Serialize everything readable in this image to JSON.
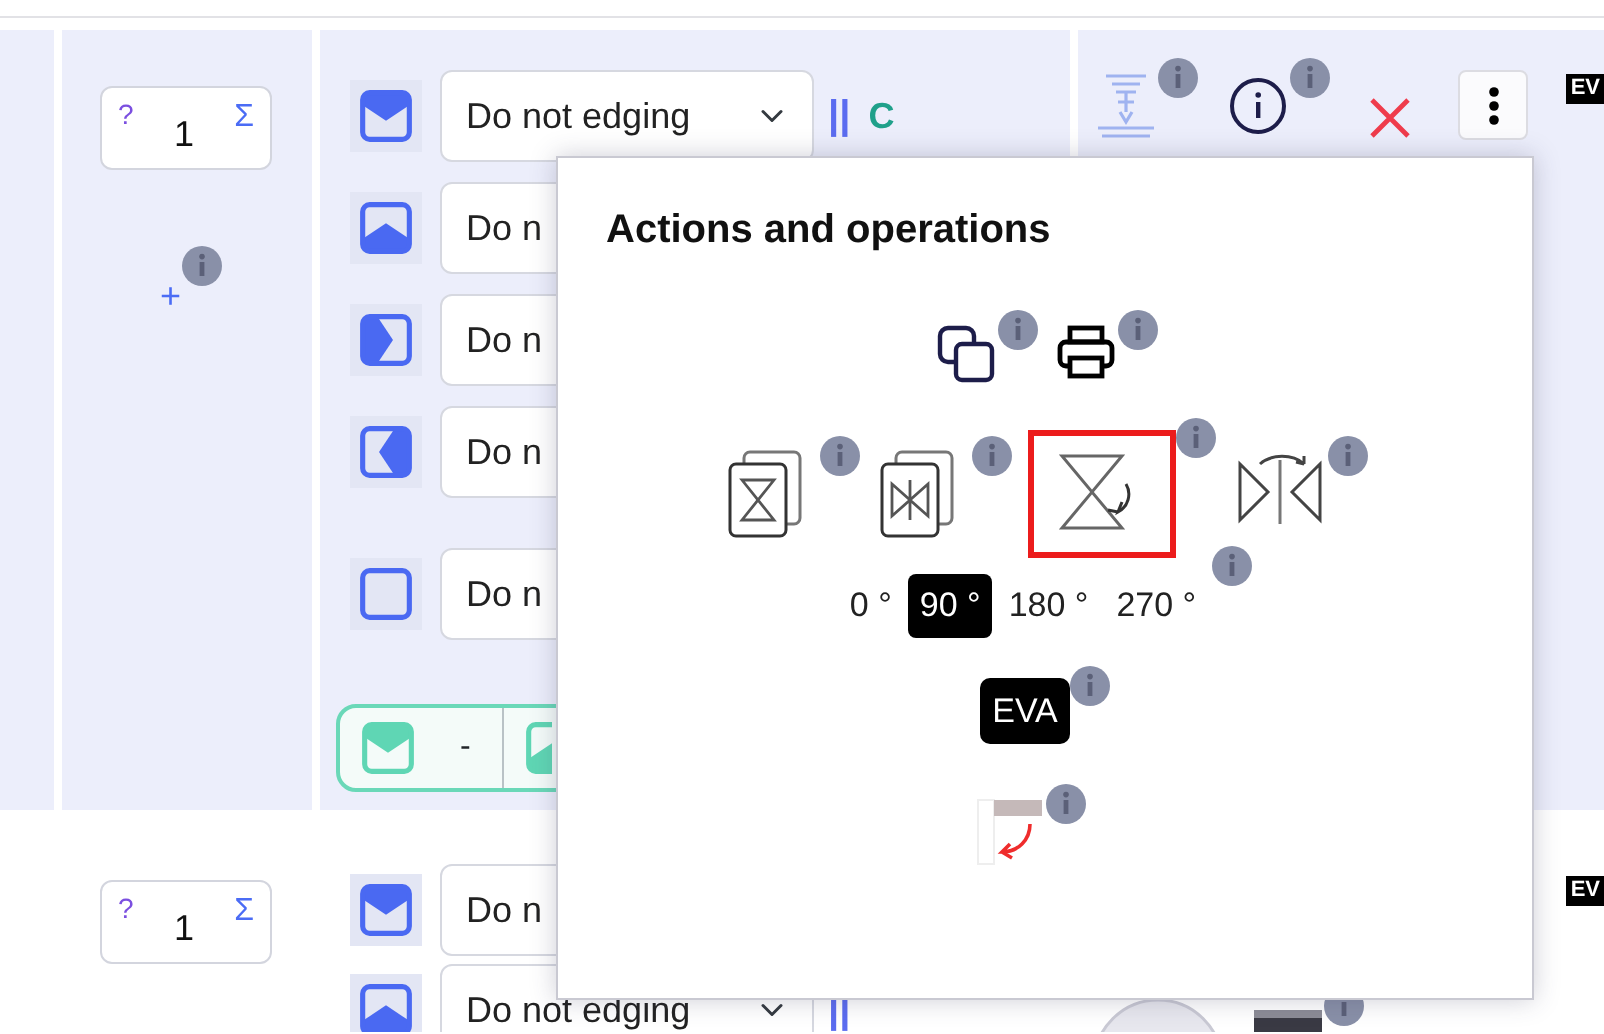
{
  "rows": [
    {
      "quantity": {
        "hint": "?",
        "value": "1",
        "total": "Σ"
      },
      "add": "+",
      "edges": [
        {
          "kind": "top",
          "value": "Do not edging",
          "marks": [
            {
              "kind": "bars",
              "text": "||"
            },
            {
              "kind": "letter",
              "text": "C"
            }
          ]
        },
        {
          "kind": "bottom",
          "value": "Do n"
        },
        {
          "kind": "right",
          "value": "Do n"
        },
        {
          "kind": "left",
          "value": "Do n"
        },
        {
          "kind": "none",
          "value": "Do n"
        }
      ],
      "summary": [
        {
          "kind": "top",
          "value": "-"
        },
        {
          "kind": "bottom"
        }
      ],
      "badge": "EV"
    },
    {
      "quantity": {
        "hint": "?",
        "value": "1",
        "total": "Σ"
      },
      "edges": [
        {
          "kind": "top",
          "value": "Do n"
        },
        {
          "kind": "bottom",
          "value": "Do not edging",
          "marks": [
            {
              "kind": "bars",
              "text": "||"
            }
          ]
        }
      ],
      "badge": "EV"
    }
  ],
  "popover": {
    "title": "Actions and operations",
    "actions": [
      {
        "kind": "copy"
      },
      {
        "kind": "print"
      }
    ],
    "transforms": [
      {
        "kind": "pages-a",
        "highlighted": false
      },
      {
        "kind": "pages-b",
        "highlighted": false
      },
      {
        "kind": "rotate",
        "highlighted": true
      },
      {
        "kind": "mirror",
        "highlighted": false
      }
    ],
    "angles": [
      {
        "label": "0 °",
        "selected": false
      },
      {
        "label": "90 °",
        "selected": true
      },
      {
        "label": "180 °",
        "selected": false
      },
      {
        "label": "270 °",
        "selected": false
      }
    ],
    "material": "EVA"
  }
}
